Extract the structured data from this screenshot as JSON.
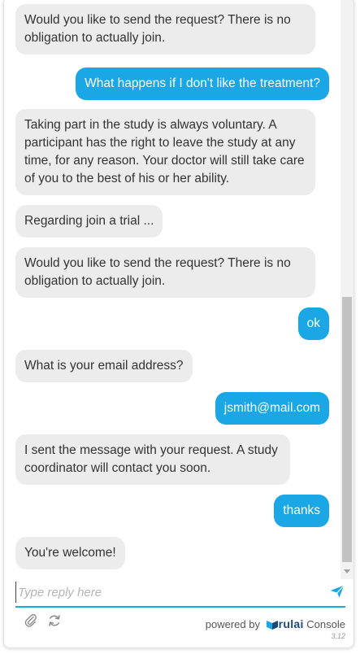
{
  "conversation": {
    "messages": [
      {
        "sender": "bot",
        "text": "Would you like to send the request? There is no obligation to actually join."
      },
      {
        "sender": "user",
        "text": "What happens if I don't like the treatment?"
      },
      {
        "sender": "bot",
        "text": "Taking part in the study is always voluntary. A participant has the right to leave the study at any time, for any reason. Your doctor will still take care of you to the best of his or her ability."
      },
      {
        "sender": "bot",
        "text": "Regarding join a trial ..."
      },
      {
        "sender": "bot",
        "text": "Would you like to send the request? There is no obligation to actually join."
      },
      {
        "sender": "user",
        "text": "ok"
      },
      {
        "sender": "bot",
        "text": "What is your email address?"
      },
      {
        "sender": "user",
        "text": "jsmith@mail.com"
      },
      {
        "sender": "bot",
        "text": "I sent the message with your request. A study coordinator will contact you soon."
      },
      {
        "sender": "user",
        "text": "thanks"
      },
      {
        "sender": "bot",
        "text": "You're welcome!"
      }
    ]
  },
  "composer": {
    "placeholder": "Type reply here",
    "send_icon": "send-icon"
  },
  "footer": {
    "attach_icon": "paperclip-icon",
    "refresh_icon": "refresh-icon",
    "powered_by": "powered by",
    "brand": "rulai",
    "console": "Console",
    "version": "3.12"
  },
  "colors": {
    "user_bubble": "#1ba7e6",
    "bot_bubble": "#ececec",
    "brand": "#1b4a7a"
  }
}
